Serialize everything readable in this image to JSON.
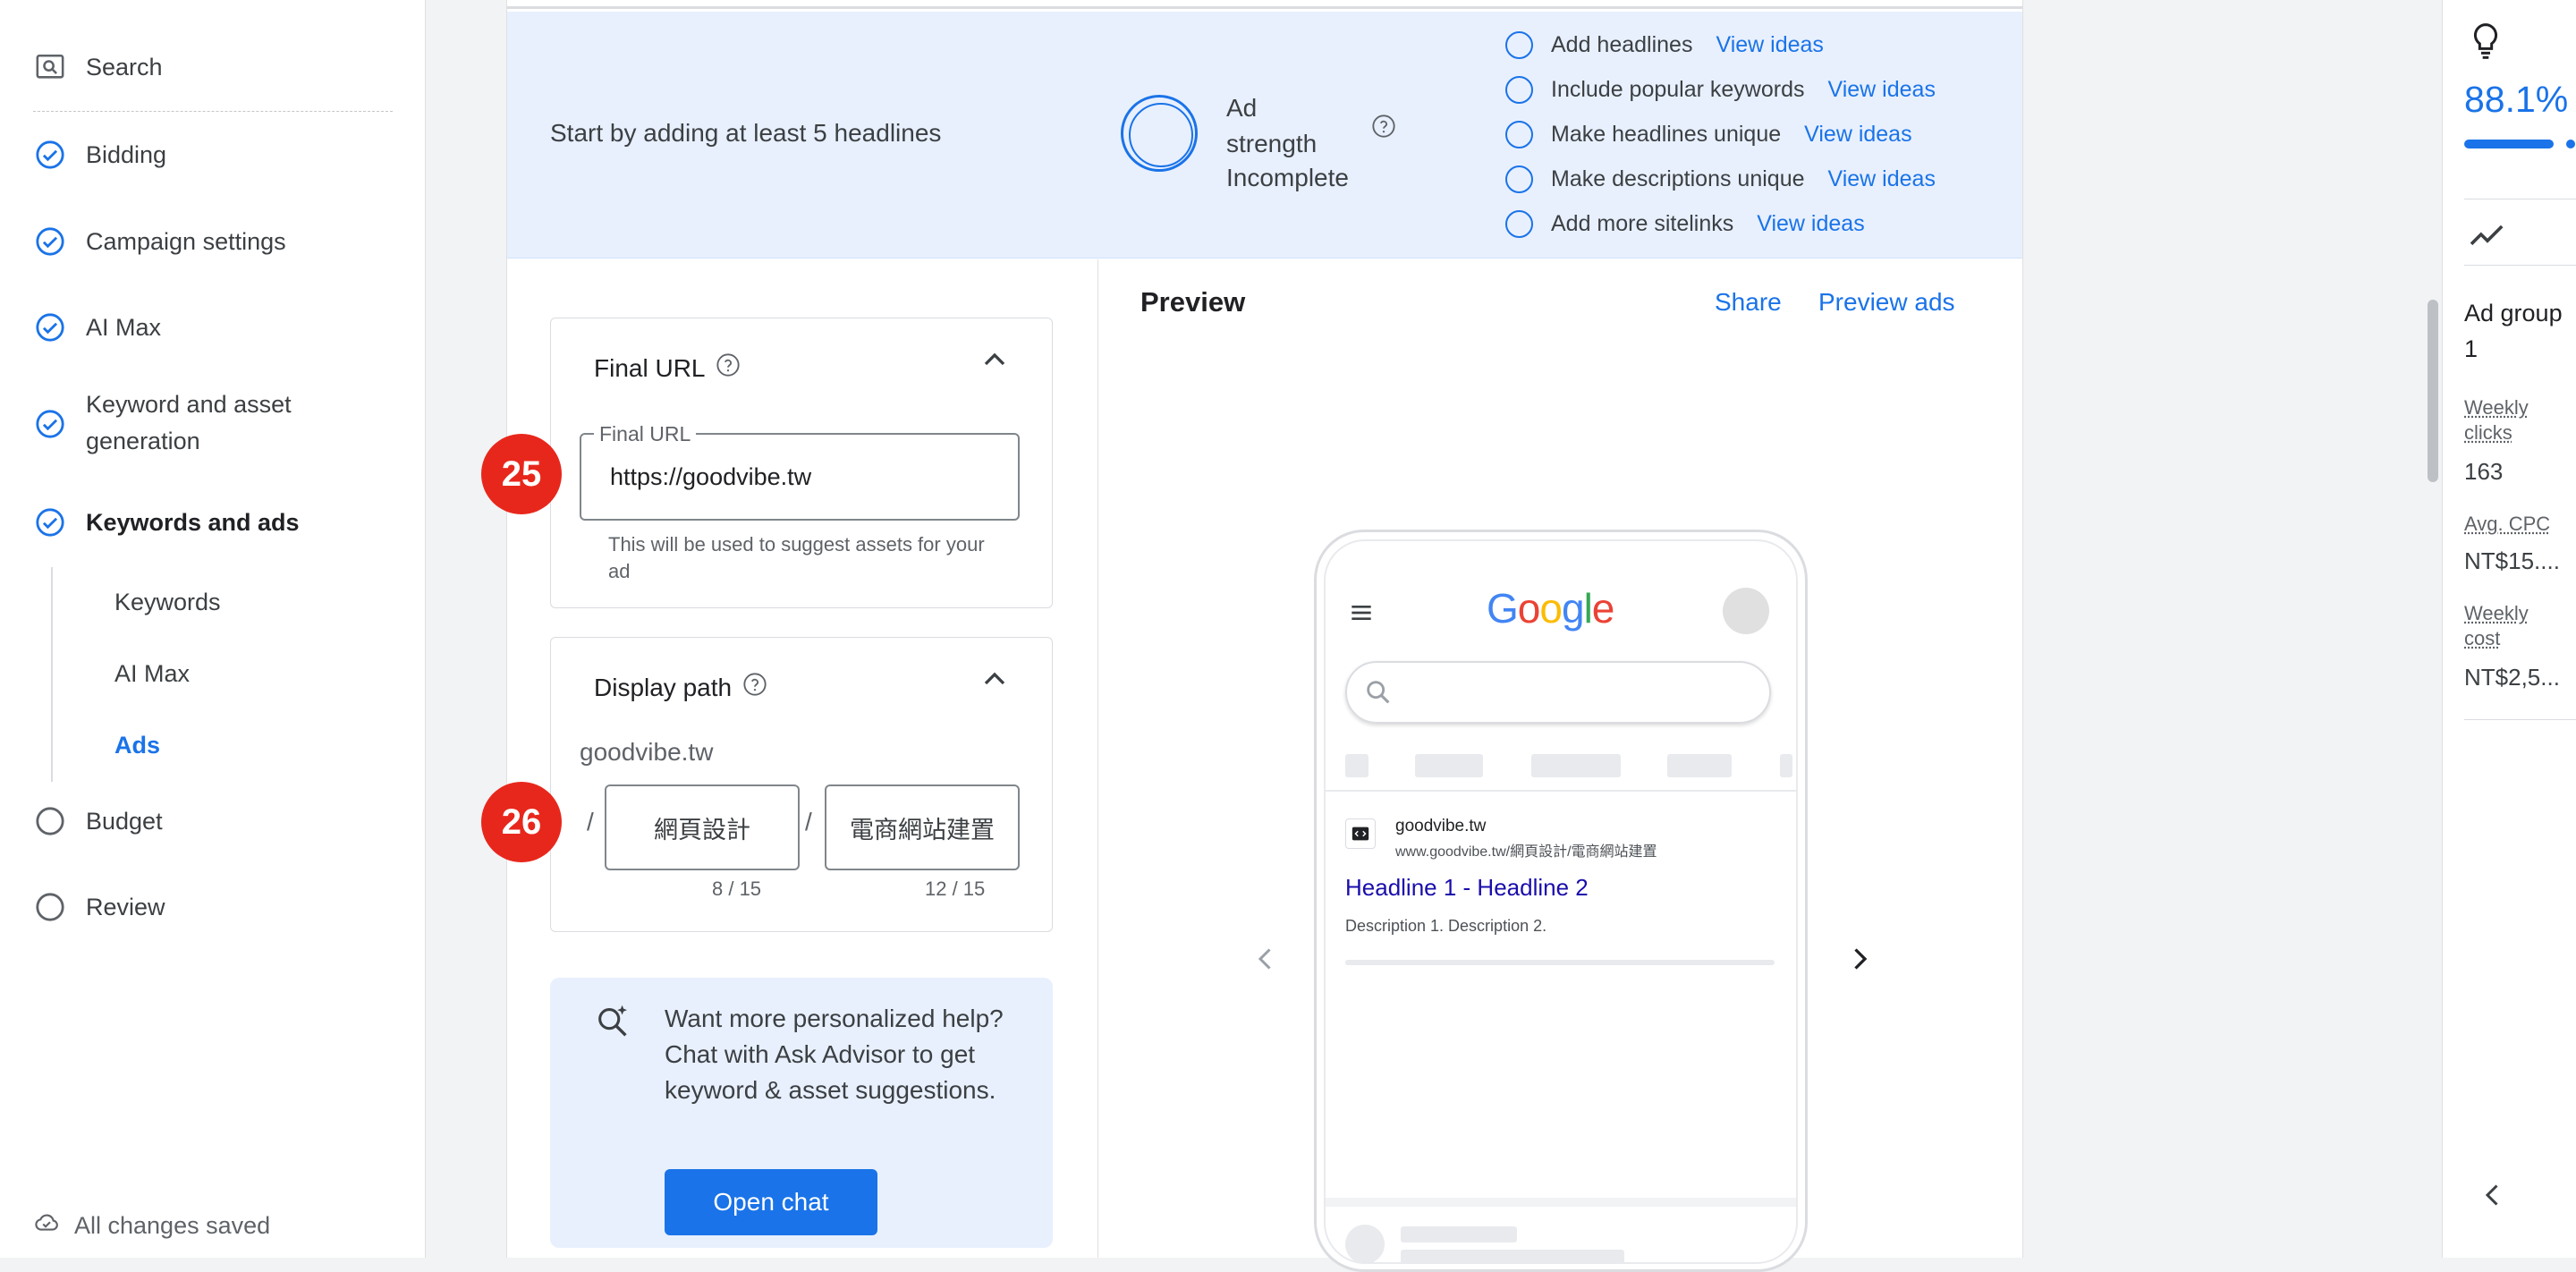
{
  "sidebar": {
    "items": [
      {
        "label": "Search",
        "icon": "search-page-icon"
      },
      {
        "label": "Bidding",
        "icon": "check-circle-icon"
      },
      {
        "label": "Campaign settings",
        "icon": "check-circle-icon"
      },
      {
        "label": "AI Max",
        "icon": "check-circle-icon"
      },
      {
        "label": "Keyword and asset generation",
        "icon": "check-circle-icon"
      },
      {
        "label": "Keywords and ads",
        "icon": "check-circle-icon"
      },
      {
        "label": "Budget",
        "icon": "empty-circle-icon"
      },
      {
        "label": "Review",
        "icon": "empty-circle-icon"
      }
    ],
    "subitems": [
      {
        "label": "Keywords"
      },
      {
        "label": "AI Max"
      },
      {
        "label": "Ads"
      }
    ],
    "status": "All changes saved"
  },
  "banner": {
    "message": "Start by adding at least 5 headlines",
    "strength_label": "Ad strength",
    "strength_status": "Incomplete",
    "suggestions": [
      {
        "text": "Add headlines",
        "link": "View ideas"
      },
      {
        "text": "Include popular keywords",
        "link": "View ideas"
      },
      {
        "text": "Make headlines unique",
        "link": "View ideas"
      },
      {
        "text": "Make descriptions unique",
        "link": "View ideas"
      },
      {
        "text": "Add more sitelinks",
        "link": "View ideas"
      }
    ]
  },
  "final_url": {
    "title": "Final URL",
    "field_label": "Final URL",
    "value": "https://goodvibe.tw",
    "hint": "This will be used to suggest assets for your ad",
    "badge": "25"
  },
  "display_path": {
    "title": "Display path",
    "domain": "goodvibe.tw",
    "slash": "/",
    "path1": "網頁設計",
    "path2": "電商網站建置",
    "count1": "8 / 15",
    "count2": "12 / 15",
    "badge": "26"
  },
  "advisor": {
    "text": "Want more personalized help? Chat with Ask Advisor to get keyword & asset suggestions.",
    "button": "Open chat"
  },
  "preview": {
    "title": "Preview",
    "share": "Share",
    "preview_ads": "Preview ads",
    "google_letters": [
      "G",
      "o",
      "o",
      "g",
      "l",
      "e"
    ],
    "google_colors": [
      "#4285f4",
      "#ea4335",
      "#fbbc05",
      "#4285f4",
      "#34a853",
      "#ea4335"
    ],
    "ad_domain": "goodvibe.tw",
    "ad_url": "www.goodvibe.tw/網頁設計/電商網站建置",
    "ad_headline": "Headline 1 - Headline 2",
    "ad_description": "Description 1. Description 2."
  },
  "right_panel": {
    "score": "88.1%",
    "score_fraction": 0.881,
    "group_name": "Ad group 1",
    "metrics": [
      {
        "label": "Weekly clicks",
        "value": "163"
      },
      {
        "label": "Avg. CPC",
        "value": "NT$15...."
      },
      {
        "label": "Weekly cost",
        "value": "NT$2,5..."
      }
    ]
  },
  "colors": {
    "accent": "#1a73e8",
    "banner_bg": "#e8f0fe",
    "badge": "#e8271c"
  }
}
